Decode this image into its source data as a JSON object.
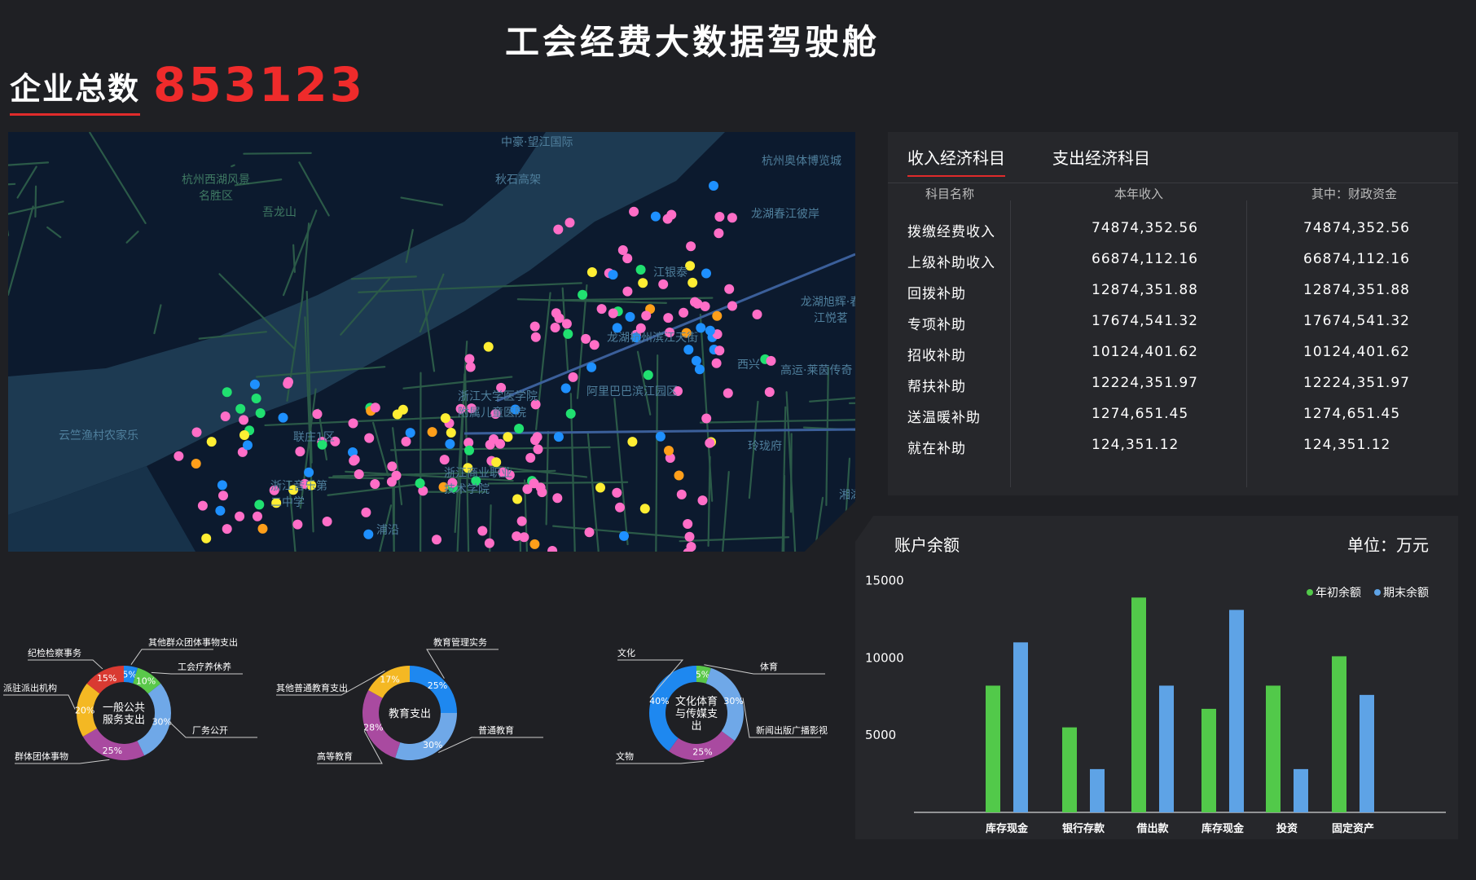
{
  "header": {
    "title": "工会经费大数据驾驶舱",
    "enterprise_label": "企业总数",
    "enterprise_count": "853123"
  },
  "map": {
    "labels": [
      "中豪·望江国际",
      "秋石高架",
      "杭州奥体博览城",
      "杭州西湖风景名胜区",
      "吾龙山",
      "龙湖春江彼岸",
      "龙湖旭辉·春江悦茗",
      "高运·莱茵传奇",
      "江银泰",
      "龙湖杭州滨江天街",
      "西兴",
      "阿里巴巴滨江园区",
      "浙江大学医学院附属儿童医院",
      "云竺渔村农家乐",
      "联庄1区",
      "浙江商业职业技术学院",
      "浙江音乐第二中学",
      "玲珑府",
      "湘湖",
      "浦沿"
    ],
    "colors": [
      "#ff6ec7",
      "#1e90ff",
      "#ffee33",
      "#20e070",
      "#ff9f1a"
    ]
  },
  "income_table": {
    "tabs": [
      "收入经济科目",
      "支出经济科目"
    ],
    "headers": [
      "科目名称",
      "本年收入",
      "其中：财政资金"
    ],
    "rows": [
      {
        "name": "拨缴经费收入",
        "income": "74874,352.56",
        "fiscal": "74874,352.56"
      },
      {
        "name": "上级补助收入",
        "income": "66874,112.16",
        "fiscal": "66874,112.16"
      },
      {
        "name": "回拨补助",
        "income": "12874,351.88",
        "fiscal": "12874,351.88"
      },
      {
        "name": "专项补助",
        "income": "17674,541.32",
        "fiscal": "17674,541.32"
      },
      {
        "name": "招收补助",
        "income": "10124,401.62",
        "fiscal": "10124,401.62"
      },
      {
        "name": "帮扶补助",
        "income": "12224,351.97",
        "fiscal": "12224,351.97"
      },
      {
        "name": "送温暖补助",
        "income": "1274,651.45",
        "fiscal": "1274,651.45"
      },
      {
        "name": "就在补助",
        "income": "124,351.12",
        "fiscal": "124,351.12"
      }
    ]
  },
  "balance_panel": {
    "title": "账户余额",
    "unit": "单位：万元",
    "legend": [
      "年初余额",
      "期末余额"
    ]
  },
  "chart_data": [
    {
      "type": "bar",
      "categories": [
        "库存现金",
        "银行存款",
        "借出款",
        "库存现金",
        "投资",
        "固定资产"
      ],
      "series": [
        {
          "name": "年初余额",
          "color": "#52c94a",
          "values": [
            8200,
            5500,
            13900,
            6700,
            8200,
            10100
          ]
        },
        {
          "name": "期末余额",
          "color": "#5ea3e6",
          "values": [
            11000,
            2800,
            8200,
            13100,
            2800,
            7600
          ]
        }
      ],
      "ylim": [
        0,
        15500
      ],
      "yticks": [
        5000,
        10000,
        15000
      ]
    },
    {
      "type": "pie",
      "center_label": [
        "一般公共",
        "服务支出"
      ],
      "slices": [
        {
          "label": "其他群众团体事物支出",
          "value": 5,
          "color": "#1e88f0"
        },
        {
          "label": "工会疗养休养",
          "value": 10,
          "color": "#5ac84a"
        },
        {
          "label": "厂务公开",
          "value": 30,
          "color": "#6fa8e8"
        },
        {
          "label": "群体团体事物",
          "value": 25,
          "color": "#a94aa0"
        },
        {
          "label": "派驻派出机构",
          "value": 20,
          "color": "#f4b823"
        },
        {
          "label": "纪检检察事务",
          "value": 15,
          "color": "#d93a32"
        }
      ]
    },
    {
      "type": "pie",
      "center_label": [
        "教育支出"
      ],
      "slices": [
        {
          "label": "教育管理实务",
          "value": 25,
          "color": "#1e88f0"
        },
        {
          "label": "普通教育",
          "value": 30,
          "color": "#6fa8e8"
        },
        {
          "label": "高等教育",
          "value": 28,
          "color": "#a94aa0"
        },
        {
          "label": "其他普通教育支出",
          "value": 17,
          "color": "#f4b823"
        }
      ]
    },
    {
      "type": "pie",
      "center_label": [
        "文化体育",
        "与传媒支",
        "出"
      ],
      "slices": [
        {
          "label": "体育",
          "value": 5,
          "color": "#5ac84a"
        },
        {
          "label": "新闻出版广播影视",
          "value": 30,
          "color": "#6fa8e8"
        },
        {
          "label": "文物",
          "value": 25,
          "color": "#a94aa0"
        },
        {
          "label": "文化",
          "value": 40,
          "color": "#1e88f0"
        }
      ]
    }
  ]
}
